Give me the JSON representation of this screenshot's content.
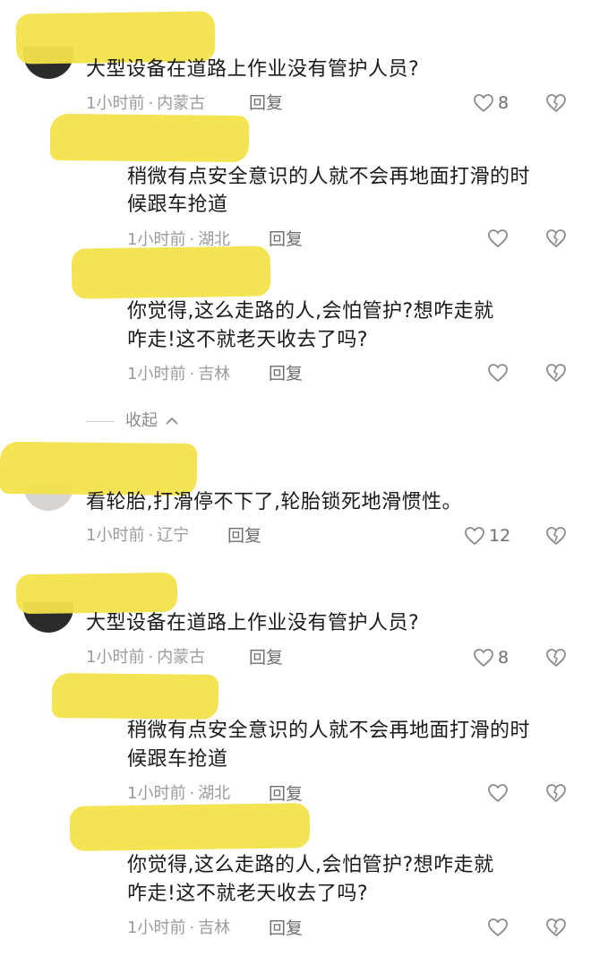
{
  "comments": [
    {
      "text": "大型设备在道路上作业没有管护人员?",
      "time": "1小时前",
      "location": "内蒙古",
      "reply": "回复",
      "likes": "8",
      "replies": [
        {
          "text_line1": "稍微有点安全意识的人就不会再地面打滑的时",
          "text_line2": "候跟车抢道",
          "time": "1小时前",
          "location": "湖北",
          "reply": "回复"
        },
        {
          "text_line1": "你觉得,这么走路的人,会怕管护?想咋走就",
          "text_line2": "咋走!这不就老天收去了吗?",
          "time": "1小时前",
          "location": "吉林",
          "reply": "回复"
        }
      ]
    },
    {
      "text": "看轮胎,打滑停不下了,轮胎锁死地滑惯性。",
      "time": "1小时前",
      "location": "辽宁",
      "reply": "回复",
      "likes": "12"
    },
    {
      "text": "大型设备在道路上作业没有管护人员?",
      "time": "1小时前",
      "location": "内蒙古",
      "reply": "回复",
      "likes": "8",
      "replies": [
        {
          "text_line1": "稍微有点安全意识的人就不会再地面打滑的时",
          "text_line2": "候跟车抢道",
          "time": "1小时前",
          "location": "湖北",
          "reply": "回复"
        },
        {
          "text_line1": "你觉得,这么走路的人,会怕管护?想咋走就",
          "text_line2": "咋走!这不就老天收去了吗?",
          "time": "1小时前",
          "location": "吉林",
          "reply": "回复"
        }
      ]
    }
  ],
  "collapse_label": "收起",
  "separator": "·",
  "icons": {
    "like": "heart-outline-icon",
    "dislike": "broken-heart-icon",
    "collapse": "chevron-up-icon"
  },
  "colors": {
    "redaction": "#f3e24a",
    "meta": "#9b9b9b",
    "text": "#1a1a1a"
  }
}
